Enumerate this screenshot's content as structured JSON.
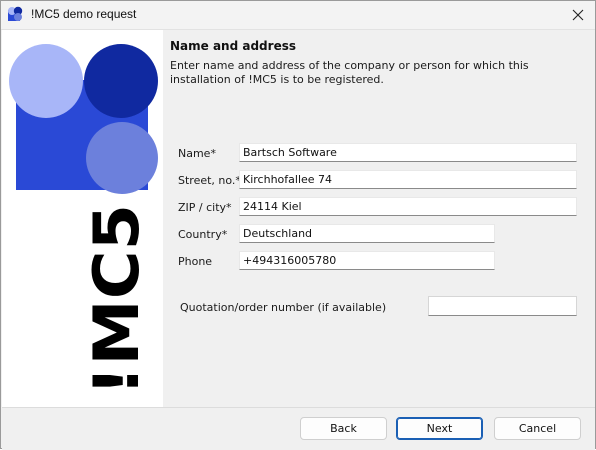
{
  "window": {
    "title": "!MC5 demo request"
  },
  "logo": {
    "text": "!MC5",
    "colors": {
      "dark_blue": "#1029a0",
      "mid_blue": "#2a49d6",
      "light_blue": "#a8b6f8",
      "soft_blue": "#6c80dc"
    }
  },
  "page": {
    "heading": "Name and address",
    "description": "Enter name and address of the company or person for which this installation of !MC5 is to be registered."
  },
  "form": {
    "name": {
      "label": "Name*",
      "value": "Bartsch Software"
    },
    "street": {
      "label": "Street, no.*",
      "value": "Kirchhofallee 74"
    },
    "zip_city": {
      "label": "ZIP / city*",
      "value": "24114 Kiel"
    },
    "country": {
      "label": "Country*",
      "value": "Deutschland"
    },
    "phone": {
      "label": "Phone",
      "value": "+494316005780"
    },
    "quotation": {
      "label": "Quotation/order number (if available)",
      "value": ""
    }
  },
  "buttons": {
    "back": "Back",
    "next": "Next",
    "cancel": "Cancel"
  }
}
